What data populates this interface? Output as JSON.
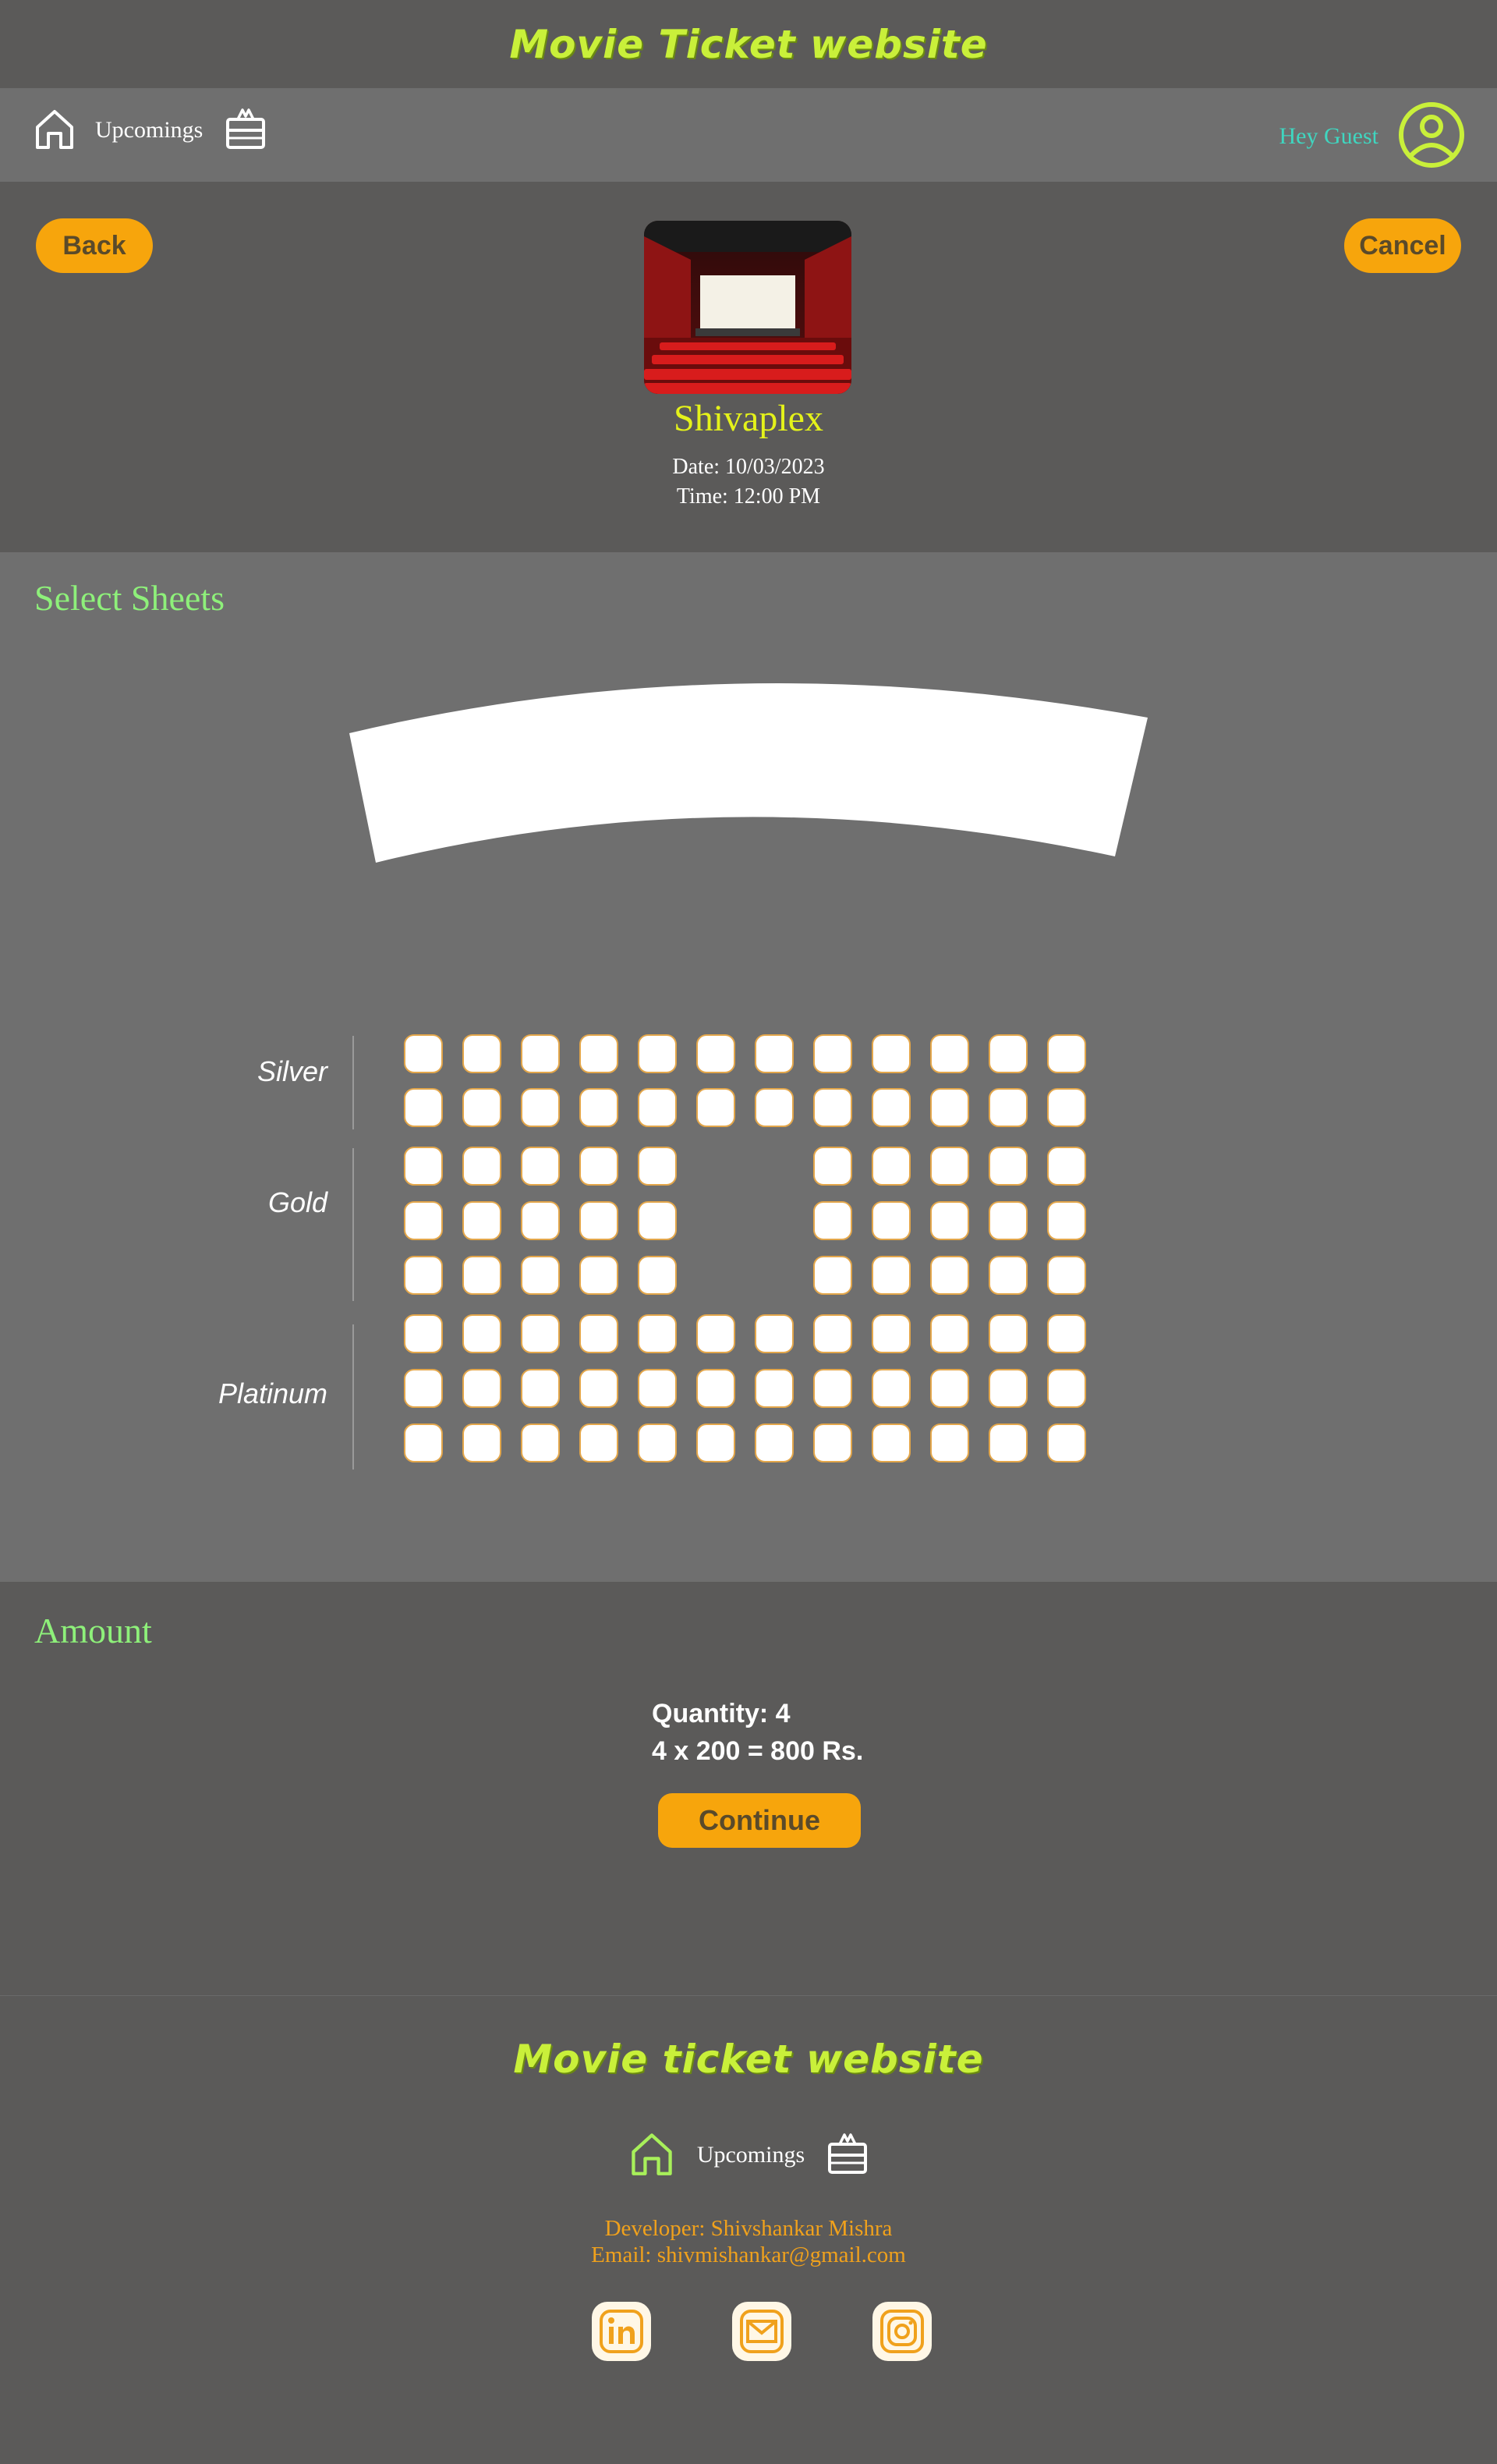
{
  "header": {
    "brand": "Movie Ticket website"
  },
  "nav": {
    "upcomings": "Upcomings",
    "greeting": "Hey Guest"
  },
  "theater": {
    "name": "Shivaplex",
    "date": "Date: 10/03/2023",
    "time": "Time: 12:00 PM",
    "back_label": "Back",
    "cancel_label": "Cancel"
  },
  "seats": {
    "heading": "Select Sheets",
    "categories": [
      "Silver",
      "Gold",
      "Platinum"
    ]
  },
  "amount": {
    "heading": "Amount",
    "quantity": "Quantity: 4",
    "total": "4 x 200 = 800 Rs.",
    "continue_label": "Continue"
  },
  "footer": {
    "brand": "Movie ticket website",
    "upcomings": "Upcomings",
    "developer": "Developer: Shivshankar Mishra",
    "email": "Email: shivmishankar@gmail.com"
  },
  "colors": {
    "accent": "#f7a50c",
    "brand": "#c9f03a",
    "heading": "#8ef07a",
    "title": "#e4f21a"
  },
  "icons": [
    "home-icon",
    "ticket-icon",
    "user-icon",
    "linkedin-icon",
    "mail-icon",
    "instagram-icon"
  ]
}
